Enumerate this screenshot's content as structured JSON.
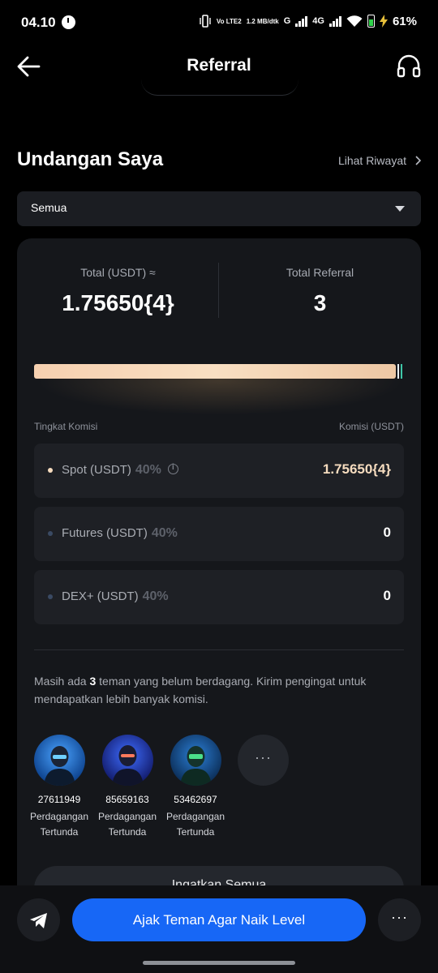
{
  "status_bar": {
    "time": "04.10",
    "network_top": "Vo LTE2",
    "speed": "1.2 MB/dtk",
    "net1": "G",
    "net2": "4G",
    "battery_pct": "61%"
  },
  "header": {
    "title": "Referral",
    "back_icon": "arrow-left-icon",
    "support_icon": "headset-icon"
  },
  "invites": {
    "title": "Undangan Saya",
    "history_link": "Lihat Riwayat",
    "filter_selected": "Semua"
  },
  "summary": {
    "total_label": "Total (USDT) ≈",
    "total_value": "1.75650{4}",
    "referral_label": "Total Referral",
    "referral_value": "3"
  },
  "commission": {
    "left_header": "Tingkat Komisi",
    "right_header": "Komisi (USDT)",
    "rows": [
      {
        "name": "Spot (USDT)",
        "pct": "40%",
        "value": "1.75650{4}",
        "value_color": "#f6dcbf",
        "dot_color": "#f6dcbf"
      },
      {
        "name": "Futures (USDT)",
        "pct": "40%",
        "value": "0",
        "value_color": "#ffffff",
        "dot_color": "#3a4a63"
      },
      {
        "name": "DEX+ (USDT)",
        "pct": "40%",
        "value": "0",
        "value_color": "#ffffff",
        "dot_color": "#3a4a63"
      }
    ]
  },
  "reminder": {
    "prefix": "Masih ada ",
    "count": "3",
    "suffix": " teman yang belum berdagang. Kirim pengingat untuk mendapatkan lebih banyak komisi."
  },
  "friends": [
    {
      "id": "27611949",
      "status_line1": "Perdagangan",
      "status_line2": "Tertunda"
    },
    {
      "id": "85659163",
      "status_line1": "Perdagangan",
      "status_line2": "Tertunda"
    },
    {
      "id": "53462697",
      "status_line1": "Perdagangan",
      "status_line2": "Tertunda"
    }
  ],
  "more_label": "···",
  "remind_all": "Ingatkan Semua",
  "bottom": {
    "cta": "Ajak Teman Agar Naik Level",
    "more": "···"
  },
  "colors": {
    "accent": "#1767f6",
    "highlight": "#f6dcbf"
  }
}
